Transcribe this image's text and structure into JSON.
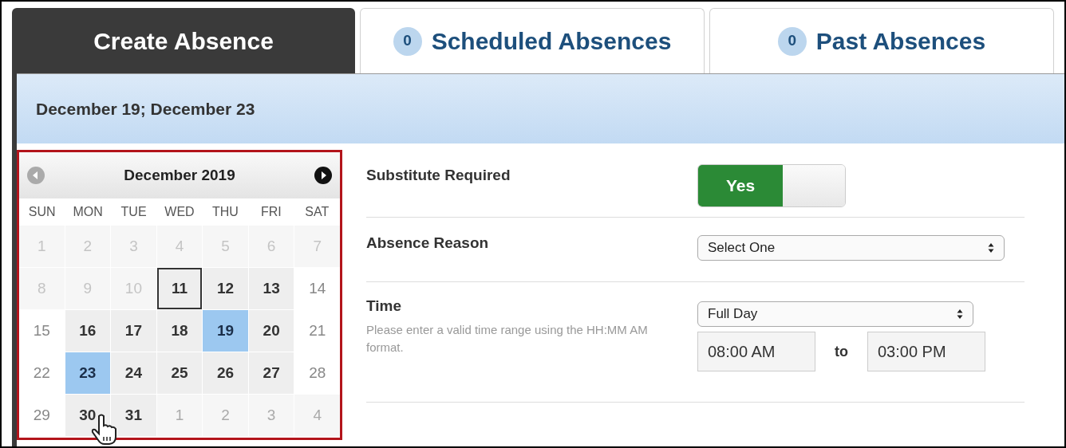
{
  "tabs": [
    {
      "label": "Create Absence",
      "selected": true
    },
    {
      "label": "Scheduled Absences",
      "count": "0",
      "selected": false
    },
    {
      "label": "Past Absences",
      "count": "0",
      "selected": false
    }
  ],
  "selected_dates": "December 19; December 23",
  "calendar": {
    "month": "December 2019",
    "prev_enabled": false,
    "next_enabled": true,
    "weekdays": [
      "SUN",
      "MON",
      "TUE",
      "WED",
      "THU",
      "FRI",
      "SAT"
    ],
    "days": [
      {
        "day": "1",
        "kind": "past",
        "selected": false,
        "today": false
      },
      {
        "day": "2",
        "kind": "past",
        "selected": false,
        "today": false
      },
      {
        "day": "3",
        "kind": "past",
        "selected": false,
        "today": false
      },
      {
        "day": "4",
        "kind": "past",
        "selected": false,
        "today": false
      },
      {
        "day": "5",
        "kind": "past",
        "selected": false,
        "today": false
      },
      {
        "day": "6",
        "kind": "past",
        "selected": false,
        "today": false
      },
      {
        "day": "7",
        "kind": "past",
        "selected": false,
        "today": false
      },
      {
        "day": "8",
        "kind": "past",
        "selected": false,
        "today": false
      },
      {
        "day": "9",
        "kind": "past",
        "selected": false,
        "today": false
      },
      {
        "day": "10",
        "kind": "past",
        "selected": false,
        "today": false
      },
      {
        "day": "11",
        "kind": "workday",
        "selected": false,
        "today": true
      },
      {
        "day": "12",
        "kind": "workday",
        "selected": false,
        "today": false
      },
      {
        "day": "13",
        "kind": "workday",
        "selected": false,
        "today": false
      },
      {
        "day": "14",
        "kind": "weekend",
        "selected": false,
        "today": false
      },
      {
        "day": "15",
        "kind": "weekend",
        "selected": false,
        "today": false
      },
      {
        "day": "16",
        "kind": "workday",
        "selected": false,
        "today": false
      },
      {
        "day": "17",
        "kind": "workday",
        "selected": false,
        "today": false
      },
      {
        "day": "18",
        "kind": "workday",
        "selected": false,
        "today": false
      },
      {
        "day": "19",
        "kind": "workday",
        "selected": true,
        "today": false
      },
      {
        "day": "20",
        "kind": "workday",
        "selected": false,
        "today": false
      },
      {
        "day": "21",
        "kind": "weekend",
        "selected": false,
        "today": false
      },
      {
        "day": "22",
        "kind": "weekend",
        "selected": false,
        "today": false
      },
      {
        "day": "23",
        "kind": "workday",
        "selected": true,
        "today": false
      },
      {
        "day": "24",
        "kind": "workday",
        "selected": false,
        "today": false
      },
      {
        "day": "25",
        "kind": "workday",
        "selected": false,
        "today": false
      },
      {
        "day": "26",
        "kind": "workday",
        "selected": false,
        "today": false
      },
      {
        "day": "27",
        "kind": "workday",
        "selected": false,
        "today": false
      },
      {
        "day": "28",
        "kind": "weekend",
        "selected": false,
        "today": false
      },
      {
        "day": "29",
        "kind": "weekend",
        "selected": false,
        "today": false
      },
      {
        "day": "30",
        "kind": "workday",
        "selected": false,
        "today": false
      },
      {
        "day": "31",
        "kind": "workday",
        "selected": false,
        "today": false
      },
      {
        "day": "1",
        "kind": "next",
        "selected": false,
        "today": false
      },
      {
        "day": "2",
        "kind": "next",
        "selected": false,
        "today": false
      },
      {
        "day": "3",
        "kind": "next",
        "selected": false,
        "today": false
      },
      {
        "day": "4",
        "kind": "next",
        "selected": false,
        "today": false
      }
    ]
  },
  "form": {
    "substitute": {
      "label": "Substitute Required",
      "on": true,
      "on_label": "Yes"
    },
    "reason": {
      "label": "Absence Reason",
      "value": "Select One"
    },
    "time": {
      "label": "Time",
      "hint": "Please enter a valid time range using the HH:MM AM format.",
      "range": "Full Day",
      "start": "08:00 AM",
      "separator": "to",
      "end": "03:00 PM"
    }
  }
}
